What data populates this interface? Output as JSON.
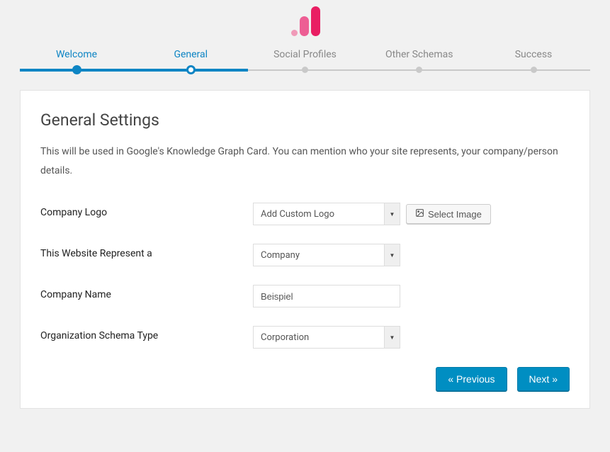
{
  "logo": {
    "semantic": "analytics-bars-logo"
  },
  "stepper": {
    "steps": [
      {
        "label": "Welcome",
        "state": "done"
      },
      {
        "label": "General",
        "state": "current"
      },
      {
        "label": "Social Profiles",
        "state": "upcoming"
      },
      {
        "label": "Other Schemas",
        "state": "upcoming"
      },
      {
        "label": "Success",
        "state": "upcoming"
      }
    ],
    "progress_percent": 40
  },
  "card": {
    "title": "General Settings",
    "description": "This will be used in Google's Knowledge Graph Card. You can mention who your site represents, your company/person details.",
    "fields": {
      "company_logo": {
        "label": "Company Logo",
        "select_value": "Add Custom Logo",
        "button_label": "Select Image"
      },
      "represent": {
        "label": "This Website Represent a",
        "select_value": "Company"
      },
      "company_name": {
        "label": "Company Name",
        "value": "Beispiel"
      },
      "org_schema": {
        "label": "Organization Schema Type",
        "select_value": "Corporation"
      }
    },
    "buttons": {
      "previous": "« Previous",
      "next": "Next »"
    }
  }
}
